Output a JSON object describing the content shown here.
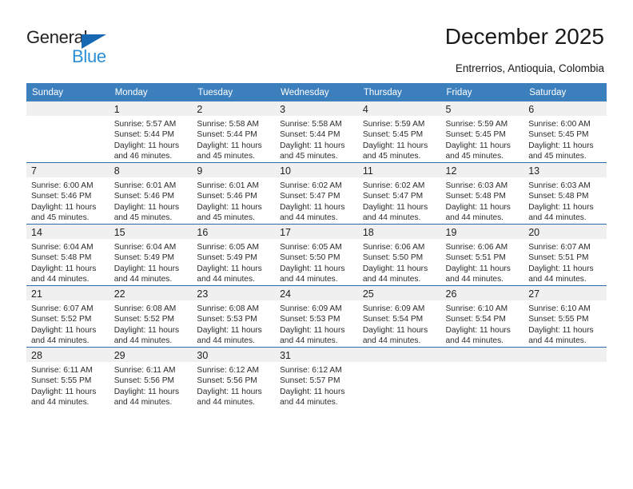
{
  "brand": {
    "name_primary": "General",
    "name_secondary": "Blue",
    "primary_color": "#231f20",
    "secondary_color": "#2c8ed4",
    "triangle_color": "#1668b3"
  },
  "header": {
    "title": "December 2025",
    "subtitle": "Entrerrios, Antioquia, Colombia"
  },
  "theme": {
    "header_row_bg": "#3c7fbd",
    "week_border": "#2a6ba8",
    "daynum_band_bg": "#f0f0f0"
  },
  "weekday_headers": [
    "Sunday",
    "Monday",
    "Tuesday",
    "Wednesday",
    "Thursday",
    "Friday",
    "Saturday"
  ],
  "weeks": [
    [
      {
        "day": "",
        "sunrise": "",
        "sunset": "",
        "daylight1": "",
        "daylight2": "",
        "empty": true
      },
      {
        "day": "1",
        "sunrise": "Sunrise: 5:57 AM",
        "sunset": "Sunset: 5:44 PM",
        "daylight1": "Daylight: 11 hours",
        "daylight2": "and 46 minutes."
      },
      {
        "day": "2",
        "sunrise": "Sunrise: 5:58 AM",
        "sunset": "Sunset: 5:44 PM",
        "daylight1": "Daylight: 11 hours",
        "daylight2": "and 45 minutes."
      },
      {
        "day": "3",
        "sunrise": "Sunrise: 5:58 AM",
        "sunset": "Sunset: 5:44 PM",
        "daylight1": "Daylight: 11 hours",
        "daylight2": "and 45 minutes."
      },
      {
        "day": "4",
        "sunrise": "Sunrise: 5:59 AM",
        "sunset": "Sunset: 5:45 PM",
        "daylight1": "Daylight: 11 hours",
        "daylight2": "and 45 minutes."
      },
      {
        "day": "5",
        "sunrise": "Sunrise: 5:59 AM",
        "sunset": "Sunset: 5:45 PM",
        "daylight1": "Daylight: 11 hours",
        "daylight2": "and 45 minutes."
      },
      {
        "day": "6",
        "sunrise": "Sunrise: 6:00 AM",
        "sunset": "Sunset: 5:45 PM",
        "daylight1": "Daylight: 11 hours",
        "daylight2": "and 45 minutes."
      }
    ],
    [
      {
        "day": "7",
        "sunrise": "Sunrise: 6:00 AM",
        "sunset": "Sunset: 5:46 PM",
        "daylight1": "Daylight: 11 hours",
        "daylight2": "and 45 minutes."
      },
      {
        "day": "8",
        "sunrise": "Sunrise: 6:01 AM",
        "sunset": "Sunset: 5:46 PM",
        "daylight1": "Daylight: 11 hours",
        "daylight2": "and 45 minutes."
      },
      {
        "day": "9",
        "sunrise": "Sunrise: 6:01 AM",
        "sunset": "Sunset: 5:46 PM",
        "daylight1": "Daylight: 11 hours",
        "daylight2": "and 45 minutes."
      },
      {
        "day": "10",
        "sunrise": "Sunrise: 6:02 AM",
        "sunset": "Sunset: 5:47 PM",
        "daylight1": "Daylight: 11 hours",
        "daylight2": "and 44 minutes."
      },
      {
        "day": "11",
        "sunrise": "Sunrise: 6:02 AM",
        "sunset": "Sunset: 5:47 PM",
        "daylight1": "Daylight: 11 hours",
        "daylight2": "and 44 minutes."
      },
      {
        "day": "12",
        "sunrise": "Sunrise: 6:03 AM",
        "sunset": "Sunset: 5:48 PM",
        "daylight1": "Daylight: 11 hours",
        "daylight2": "and 44 minutes."
      },
      {
        "day": "13",
        "sunrise": "Sunrise: 6:03 AM",
        "sunset": "Sunset: 5:48 PM",
        "daylight1": "Daylight: 11 hours",
        "daylight2": "and 44 minutes."
      }
    ],
    [
      {
        "day": "14",
        "sunrise": "Sunrise: 6:04 AM",
        "sunset": "Sunset: 5:48 PM",
        "daylight1": "Daylight: 11 hours",
        "daylight2": "and 44 minutes."
      },
      {
        "day": "15",
        "sunrise": "Sunrise: 6:04 AM",
        "sunset": "Sunset: 5:49 PM",
        "daylight1": "Daylight: 11 hours",
        "daylight2": "and 44 minutes."
      },
      {
        "day": "16",
        "sunrise": "Sunrise: 6:05 AM",
        "sunset": "Sunset: 5:49 PM",
        "daylight1": "Daylight: 11 hours",
        "daylight2": "and 44 minutes."
      },
      {
        "day": "17",
        "sunrise": "Sunrise: 6:05 AM",
        "sunset": "Sunset: 5:50 PM",
        "daylight1": "Daylight: 11 hours",
        "daylight2": "and 44 minutes."
      },
      {
        "day": "18",
        "sunrise": "Sunrise: 6:06 AM",
        "sunset": "Sunset: 5:50 PM",
        "daylight1": "Daylight: 11 hours",
        "daylight2": "and 44 minutes."
      },
      {
        "day": "19",
        "sunrise": "Sunrise: 6:06 AM",
        "sunset": "Sunset: 5:51 PM",
        "daylight1": "Daylight: 11 hours",
        "daylight2": "and 44 minutes."
      },
      {
        "day": "20",
        "sunrise": "Sunrise: 6:07 AM",
        "sunset": "Sunset: 5:51 PM",
        "daylight1": "Daylight: 11 hours",
        "daylight2": "and 44 minutes."
      }
    ],
    [
      {
        "day": "21",
        "sunrise": "Sunrise: 6:07 AM",
        "sunset": "Sunset: 5:52 PM",
        "daylight1": "Daylight: 11 hours",
        "daylight2": "and 44 minutes."
      },
      {
        "day": "22",
        "sunrise": "Sunrise: 6:08 AM",
        "sunset": "Sunset: 5:52 PM",
        "daylight1": "Daylight: 11 hours",
        "daylight2": "and 44 minutes."
      },
      {
        "day": "23",
        "sunrise": "Sunrise: 6:08 AM",
        "sunset": "Sunset: 5:53 PM",
        "daylight1": "Daylight: 11 hours",
        "daylight2": "and 44 minutes."
      },
      {
        "day": "24",
        "sunrise": "Sunrise: 6:09 AM",
        "sunset": "Sunset: 5:53 PM",
        "daylight1": "Daylight: 11 hours",
        "daylight2": "and 44 minutes."
      },
      {
        "day": "25",
        "sunrise": "Sunrise: 6:09 AM",
        "sunset": "Sunset: 5:54 PM",
        "daylight1": "Daylight: 11 hours",
        "daylight2": "and 44 minutes."
      },
      {
        "day": "26",
        "sunrise": "Sunrise: 6:10 AM",
        "sunset": "Sunset: 5:54 PM",
        "daylight1": "Daylight: 11 hours",
        "daylight2": "and 44 minutes."
      },
      {
        "day": "27",
        "sunrise": "Sunrise: 6:10 AM",
        "sunset": "Sunset: 5:55 PM",
        "daylight1": "Daylight: 11 hours",
        "daylight2": "and 44 minutes."
      }
    ],
    [
      {
        "day": "28",
        "sunrise": "Sunrise: 6:11 AM",
        "sunset": "Sunset: 5:55 PM",
        "daylight1": "Daylight: 11 hours",
        "daylight2": "and 44 minutes."
      },
      {
        "day": "29",
        "sunrise": "Sunrise: 6:11 AM",
        "sunset": "Sunset: 5:56 PM",
        "daylight1": "Daylight: 11 hours",
        "daylight2": "and 44 minutes."
      },
      {
        "day": "30",
        "sunrise": "Sunrise: 6:12 AM",
        "sunset": "Sunset: 5:56 PM",
        "daylight1": "Daylight: 11 hours",
        "daylight2": "and 44 minutes."
      },
      {
        "day": "31",
        "sunrise": "Sunrise: 6:12 AM",
        "sunset": "Sunset: 5:57 PM",
        "daylight1": "Daylight: 11 hours",
        "daylight2": "and 44 minutes."
      },
      {
        "day": "",
        "sunrise": "",
        "sunset": "",
        "daylight1": "",
        "daylight2": "",
        "empty": true
      },
      {
        "day": "",
        "sunrise": "",
        "sunset": "",
        "daylight1": "",
        "daylight2": "",
        "empty": true
      },
      {
        "day": "",
        "sunrise": "",
        "sunset": "",
        "daylight1": "",
        "daylight2": "",
        "empty": true
      }
    ]
  ]
}
